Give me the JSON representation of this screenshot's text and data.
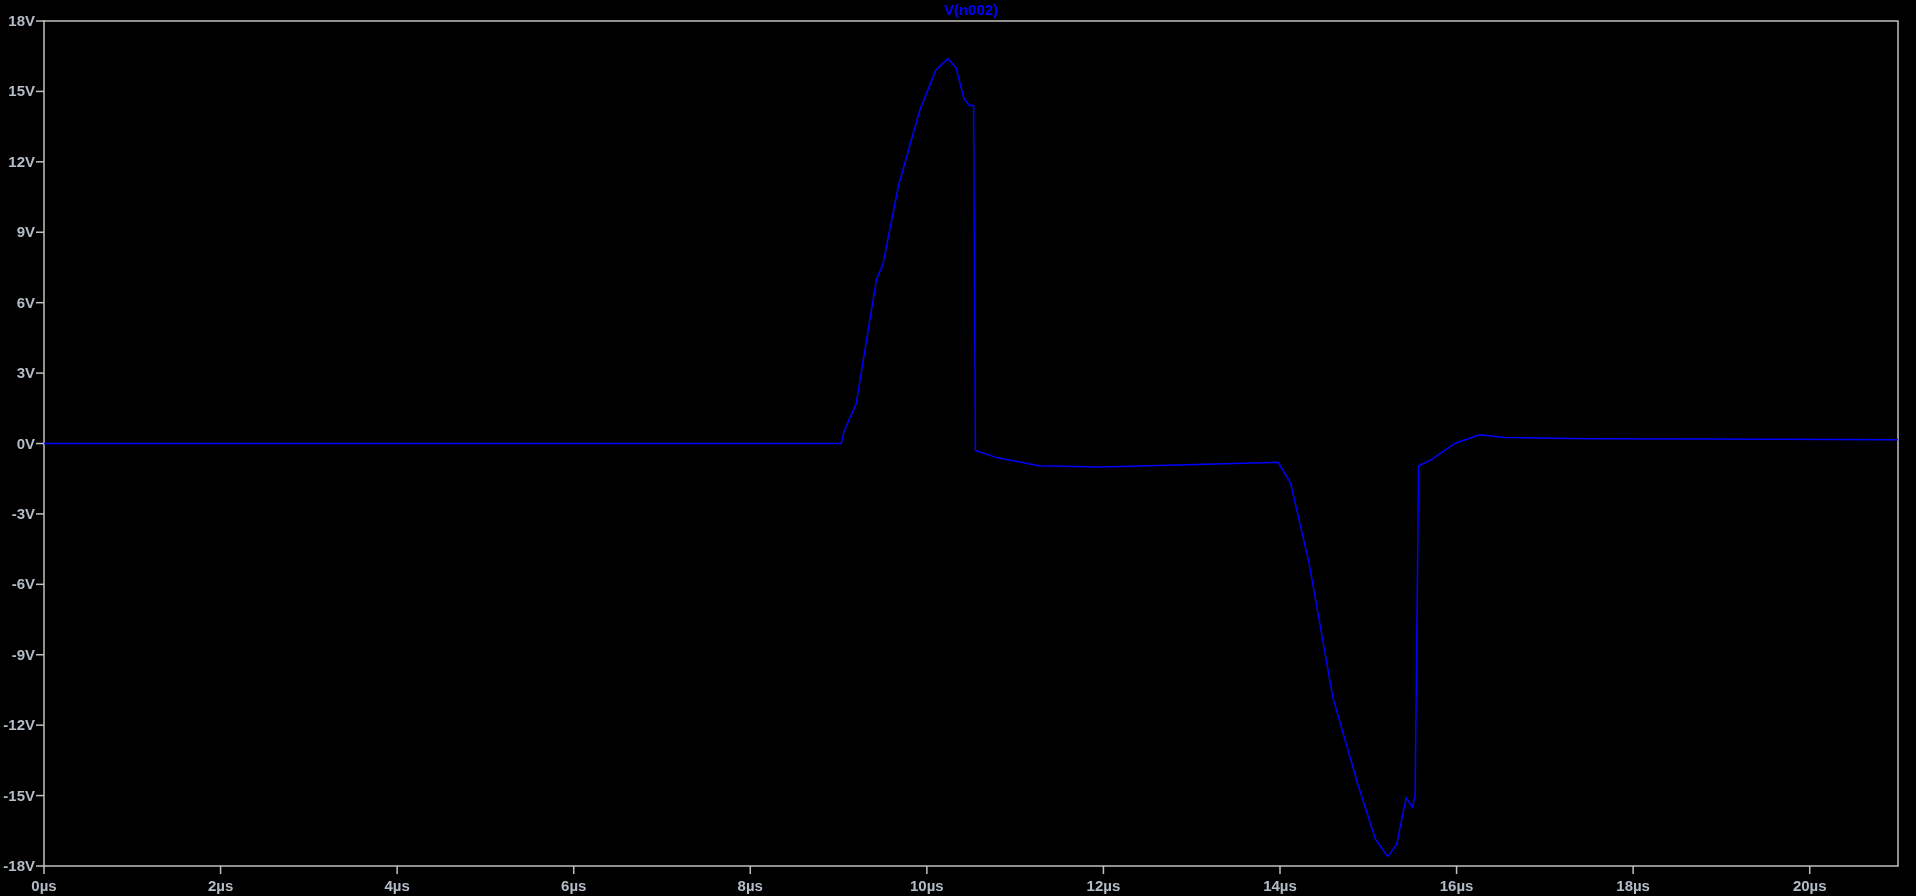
{
  "plot": {
    "chart_data": {
      "type": "line",
      "xlim": [
        0,
        21
      ],
      "ylim": [
        -18,
        18
      ],
      "xticks": [
        {
          "value": 0,
          "label": "0µs"
        },
        {
          "value": 2,
          "label": "2µs"
        },
        {
          "value": 4,
          "label": "4µs"
        },
        {
          "value": 6,
          "label": "6µs"
        },
        {
          "value": 8,
          "label": "8µs"
        },
        {
          "value": 10,
          "label": "10µs"
        },
        {
          "value": 12,
          "label": "12µs"
        },
        {
          "value": 14,
          "label": "14µs"
        },
        {
          "value": 16,
          "label": "16µs"
        },
        {
          "value": 18,
          "label": "18µs"
        },
        {
          "value": 20,
          "label": "20µs"
        }
      ],
      "yticks": [
        {
          "value": 18,
          "label": "18V"
        },
        {
          "value": 15,
          "label": "15V"
        },
        {
          "value": 12,
          "label": "12V"
        },
        {
          "value": 9,
          "label": "9V"
        },
        {
          "value": 6,
          "label": "6V"
        },
        {
          "value": 3,
          "label": "3V"
        },
        {
          "value": 0,
          "label": "0V"
        },
        {
          "value": -3,
          "label": "-3V"
        },
        {
          "value": -6,
          "label": "-6V"
        },
        {
          "value": -9,
          "label": "-9V"
        },
        {
          "value": -12,
          "label": "-12V"
        },
        {
          "value": -15,
          "label": "-15V"
        },
        {
          "value": -18,
          "label": "-18V"
        }
      ],
      "x": [
        0,
        9.03,
        9.06,
        9.2,
        9.43,
        9.5,
        9.68,
        9.92,
        10.1,
        10.24,
        10.33,
        10.42,
        10.48,
        10.53,
        10.55,
        10.79,
        11.27,
        11.97,
        13.98,
        14.12,
        14.33,
        14.6,
        14.88,
        15.08,
        15.22,
        15.32,
        15.43,
        15.5,
        15.53,
        15.57,
        15.71,
        15.98,
        16.26,
        16.54,
        17.5,
        21
      ],
      "series": [
        {
          "name": "V(n002)",
          "color": "#0000ff",
          "values": [
            0,
            0,
            0.5,
            1.7,
            7,
            7.6,
            11,
            14.2,
            15.9,
            16.4,
            16,
            14.7,
            14.4,
            14.4,
            -0.3,
            -0.6,
            -0.95,
            -1,
            -0.8,
            -1.7,
            -5.1,
            -10.85,
            -14.5,
            -16.85,
            -17.6,
            -17.1,
            -15.1,
            -15.5,
            -15,
            -0.95,
            -0.7,
            0,
            0.37,
            0.26,
            0.2,
            0.16
          ]
        }
      ]
    }
  }
}
